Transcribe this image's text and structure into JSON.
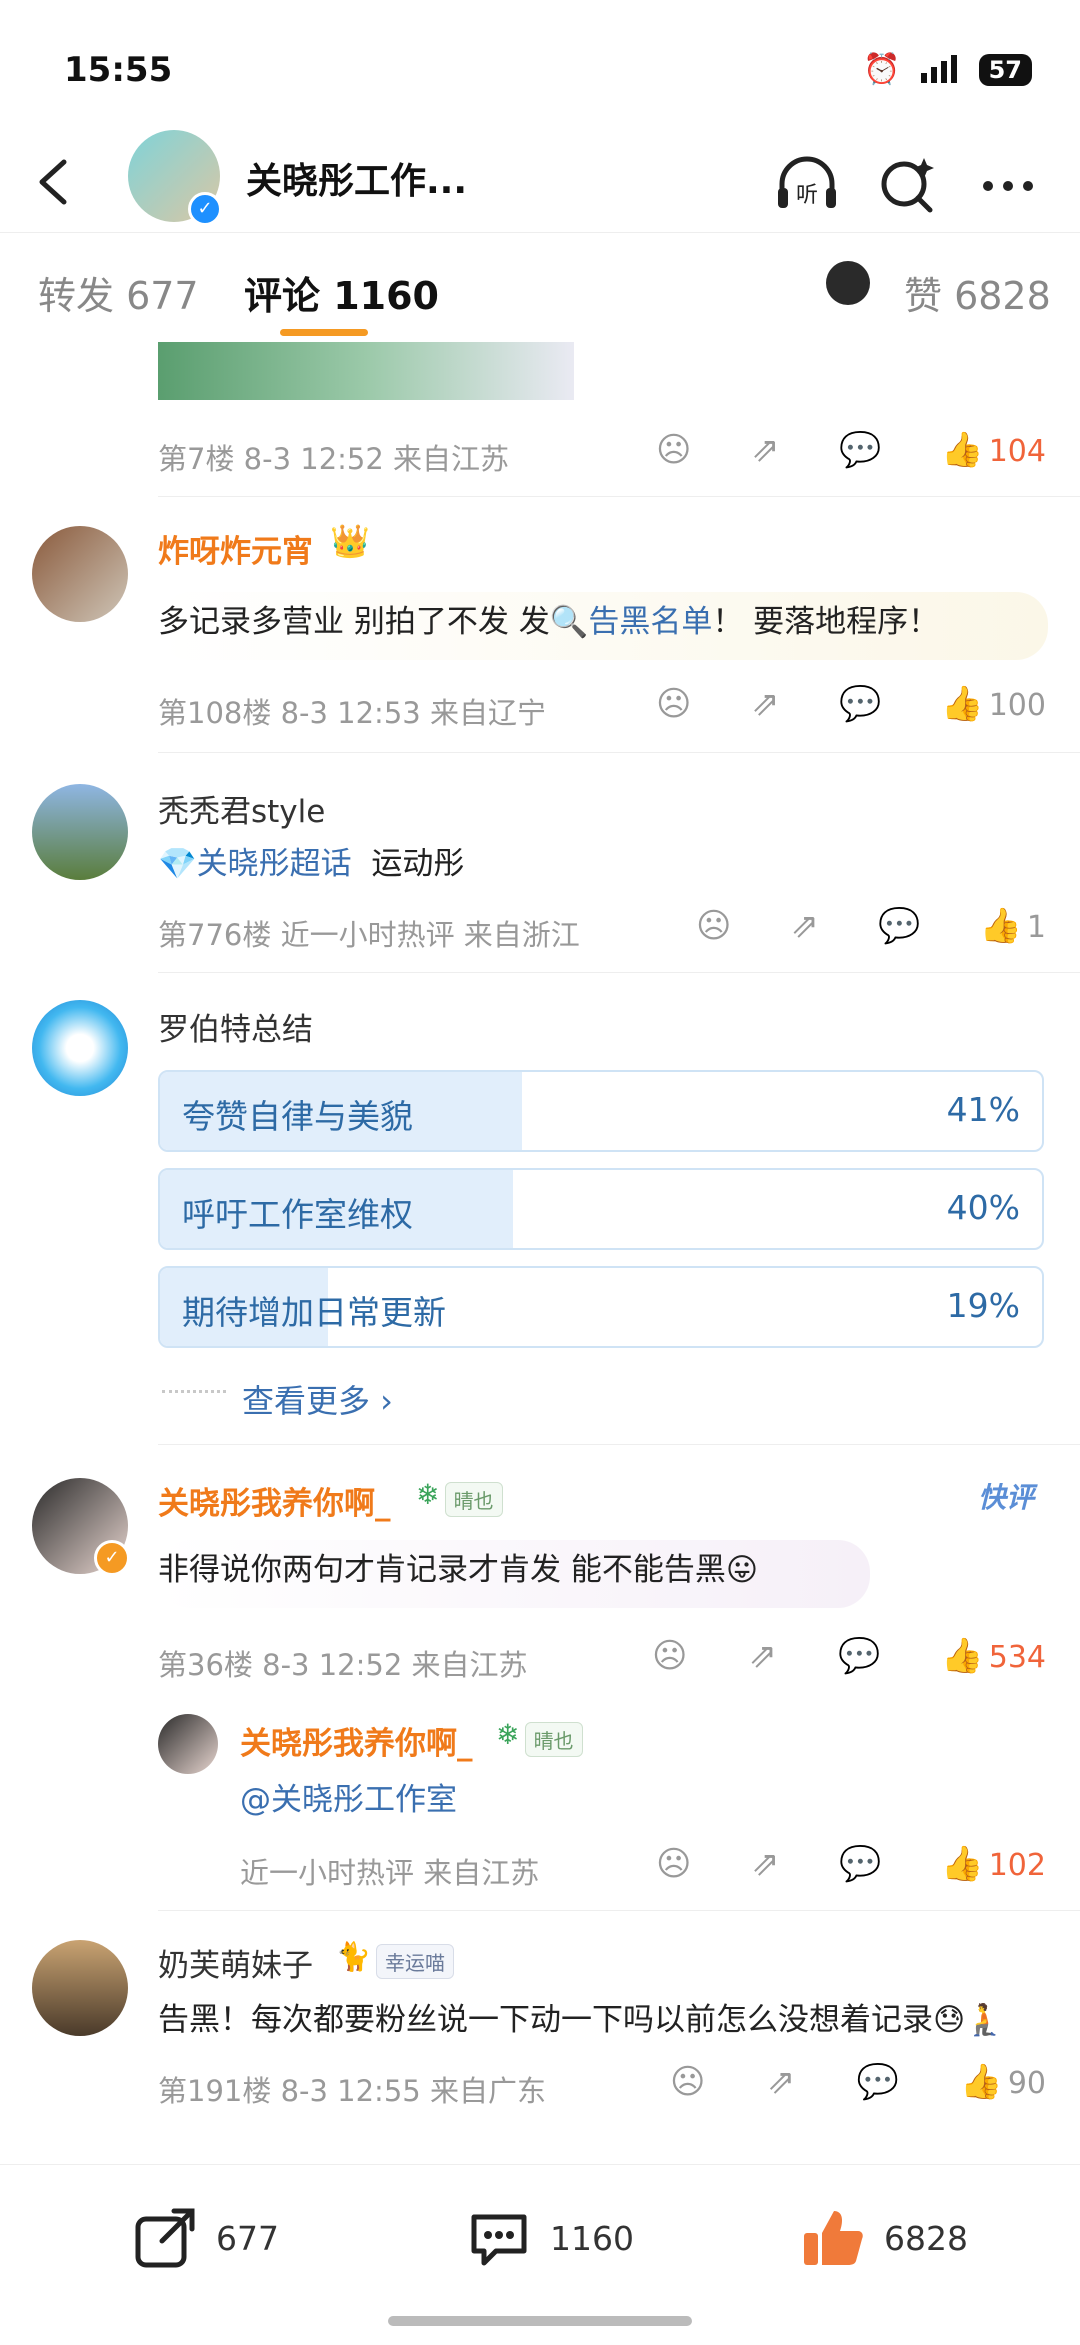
{
  "status": {
    "time": "15:55",
    "battery": "57"
  },
  "header": {
    "title": "关晓彤工作...",
    "listen_label": "听"
  },
  "tabs": {
    "repost": "转发 677",
    "comments": "评论 1160",
    "likes": "赞 6828"
  },
  "comments": [
    {
      "meta": "第7楼  8-3 12:52  来自江苏",
      "likes": "104"
    },
    {
      "user": "炸呀炸元宵",
      "text_a": "多记录多营业 别拍了不发 发",
      "topic": "告黑名单",
      "text_b": "！ 要落地程序！",
      "meta": "第108楼  8-3 12:53  来自辽宁",
      "likes": "100"
    },
    {
      "user": "秃秃君style",
      "topic": "关晓彤超话",
      "text": "运动彤",
      "meta": "第776楼  近一小时热评  来自浙江",
      "likes": "1"
    },
    {
      "user": "罗伯特总结",
      "poll": [
        {
          "label": "夸赞自律与美貌",
          "pct": "41%",
          "value": 0.41
        },
        {
          "label": "呼吁工作室维权",
          "pct": "40%",
          "value": 0.4
        },
        {
          "label": "期待增加日常更新",
          "pct": "19%",
          "value": 0.19
        }
      ],
      "more": "查看更多 ›"
    },
    {
      "user": "关晓彤我养你啊_",
      "badge": "晴也",
      "quick": "快评",
      "text": "非得说你两句才肯记录才肯发 能不能告黑😛",
      "meta": "第36楼  8-3 12:52  来自江苏",
      "likes": "534",
      "reply": {
        "user": "关晓彤我养你啊_",
        "badge": "晴也",
        "text": "@关晓彤工作室",
        "meta": "近一小时热评  来自江苏",
        "likes": "102"
      }
    },
    {
      "user": "奶芙萌妹子",
      "badge": "幸运喵",
      "text": "告黑！每次都要粉丝说一下动一下吗以前怎么没想着记录😓🧎",
      "meta": "第191楼  8-3 12:55  来自广东",
      "likes": "90"
    }
  ],
  "bottombar": {
    "repost": "677",
    "comment": "1160",
    "like": "6828"
  }
}
